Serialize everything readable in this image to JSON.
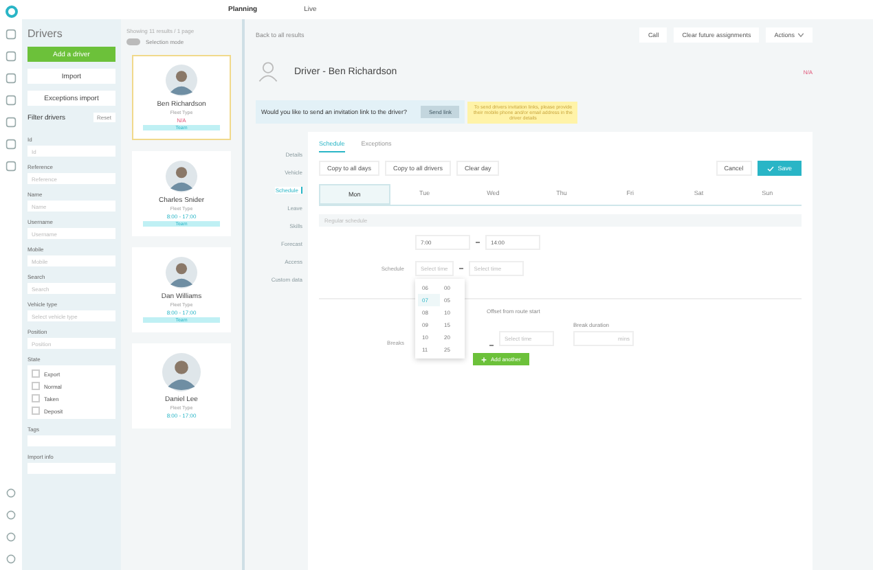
{
  "topbar": {
    "tabs": [
      {
        "label": "Planning",
        "selected": true
      },
      {
        "label": "Live",
        "selected": false
      }
    ]
  },
  "filters": {
    "title": "Drivers",
    "add_button": "Add a driver",
    "import_buttons": [
      "Import",
      "Exceptions import"
    ],
    "heading": "Filter drivers",
    "reset": "Reset",
    "fields": [
      {
        "label": "Id",
        "placeholder": "Id"
      },
      {
        "label": "Reference",
        "placeholder": "Reference"
      },
      {
        "label": "Name",
        "placeholder": "Name"
      },
      {
        "label": "Username",
        "placeholder": "Username"
      },
      {
        "label": "Mobile",
        "placeholder": "Mobile"
      },
      {
        "label": "Search",
        "placeholder": "Search"
      },
      {
        "label": "Vehicle type",
        "placeholder": "Select vehicle type"
      },
      {
        "label": "Position",
        "placeholder": "Position"
      }
    ],
    "state_label": "State",
    "states": [
      {
        "label": "Export",
        "checked": false
      },
      {
        "label": "Normal",
        "checked": false
      },
      {
        "label": "Taken",
        "checked": false
      },
      {
        "label": "Deposit",
        "checked": false
      }
    ],
    "tags_label": "Tags",
    "import_label": "Import info"
  },
  "list": {
    "summary": "Showing 11 results / 1 page",
    "selection_mode": {
      "label": "Selection mode",
      "on": false
    },
    "drivers": [
      {
        "name": "Ben Richardson",
        "type": "Fleet Type",
        "status": "N/A",
        "tag": "Team",
        "selected": true
      },
      {
        "name": "Charles Snider",
        "type": "Fleet Type",
        "hours": "8:00 - 17:00",
        "tag": "Team",
        "selected": false
      },
      {
        "name": "Dan Williams",
        "type": "Fleet Type",
        "hours": "8:00 - 17:00",
        "tag": "Team",
        "selected": false
      },
      {
        "name": "Daniel Lee",
        "type": "Fleet Type",
        "hours": "8:00 - 17:00",
        "selected": false
      }
    ]
  },
  "detail": {
    "back": "Back to all results",
    "actions": [
      "Call",
      "Clear future assignments"
    ],
    "actions_menu": "Actions",
    "title": "Driver - Ben Richardson",
    "status": "N/A",
    "invite": "Would you like to send an invitation link to the driver?",
    "invite_button": "Send link",
    "warning": "To send drivers invitation links, please provide their mobile phone and/or email address in the driver details",
    "side_nav": [
      {
        "label": "Details",
        "selected": false
      },
      {
        "label": "Vehicle",
        "selected": false
      },
      {
        "label": "Schedule",
        "selected": true
      },
      {
        "label": "Leave",
        "selected": false
      },
      {
        "label": "Skills",
        "selected": false
      },
      {
        "label": "Forecast",
        "selected": false
      },
      {
        "label": "Access",
        "selected": false
      },
      {
        "label": "Custom data",
        "selected": false
      }
    ],
    "tabs": [
      {
        "label": "Schedule",
        "selected": true
      },
      {
        "label": "Exceptions",
        "selected": false
      }
    ],
    "tools": [
      "Copy to all days",
      "Copy to all drivers",
      "Clear day"
    ],
    "cancel": "Cancel",
    "save": "Save",
    "days": [
      {
        "label": "Mon",
        "selected": true
      },
      {
        "label": "Tue",
        "selected": false
      },
      {
        "label": "Wed",
        "selected": false
      },
      {
        "label": "Thu",
        "selected": false
      },
      {
        "label": "Fri",
        "selected": false
      },
      {
        "label": "Sat",
        "selected": false
      },
      {
        "label": "Sun",
        "selected": false
      }
    ],
    "section": "Regular schedule",
    "schedule_label": "Schedule",
    "start": "7:00",
    "end": "14:00",
    "start_placeholder": "Select time",
    "end_placeholder": "Select time",
    "hours": [
      {
        "label": "06",
        "selected": false
      },
      {
        "label": "07",
        "selected": true
      },
      {
        "label": "08",
        "selected": false
      },
      {
        "label": "09",
        "selected": false
      },
      {
        "label": "10",
        "selected": false
      },
      {
        "label": "11",
        "selected": false
      }
    ],
    "minutes": [
      {
        "label": "00",
        "selected": false
      },
      {
        "label": "05",
        "selected": false
      },
      {
        "label": "10",
        "selected": false
      },
      {
        "label": "15",
        "selected": false
      },
      {
        "label": "20",
        "selected": false
      },
      {
        "label": "25",
        "selected": false
      }
    ],
    "offset_label": "Offset from route start",
    "breaks_label": "Breaks",
    "break_placeholder": "Select time",
    "duration_label": "Break duration",
    "mins": "mins",
    "add_another": "Add another"
  }
}
